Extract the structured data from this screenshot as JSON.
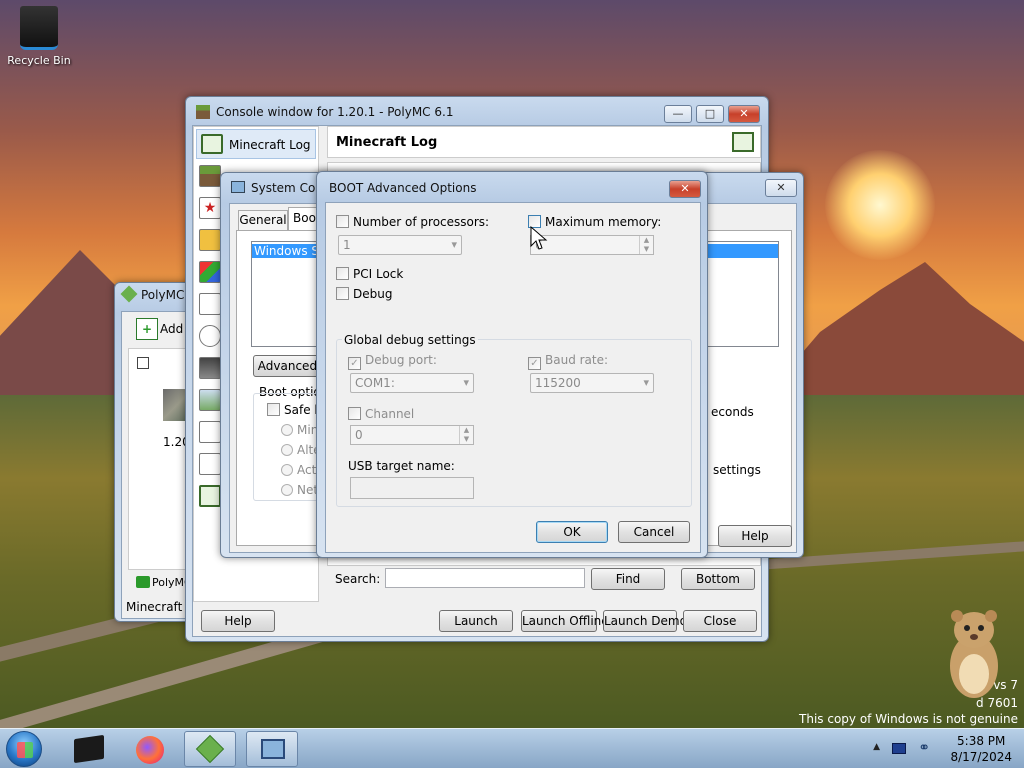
{
  "desktop": {
    "recycle_bin_label": "Recycle Bin",
    "watermark": {
      "line1": "vs 7",
      "line2": "d 7601",
      "line3": "This copy of Windows is not genuine"
    }
  },
  "polymc_main": {
    "title": "PolyMC",
    "add_label": "Add",
    "instance_version": "1.20",
    "status_tab": "PolyMC",
    "footer": "Minecraft 1"
  },
  "console_window": {
    "title": "Console window for 1.20.1 - PolyMC 6.1",
    "sidebar_selected": "Minecraft Log",
    "page_title": "Minecraft Log",
    "search_label": "Search:",
    "find_button": "Find",
    "bottom_button": "Bottom",
    "help_button": "Help",
    "launch_button": "Launch",
    "launch_offline_button": "Launch Offline",
    "launch_demo_button": "Launch Demo",
    "close_button": "Close"
  },
  "system_config": {
    "title": "System Conf",
    "tabs": [
      "General",
      "Boot"
    ],
    "os_entry": "Windows Shir",
    "advanced_button": "Advanced o",
    "boot_options_label": "Boot options",
    "safe_boot_label": "Safe bo",
    "radio_options": [
      "Minin",
      "Alter",
      "Activ",
      "Netw"
    ],
    "seconds_label": "econds",
    "settings_label": "settings",
    "help_button": "Help"
  },
  "boot_advanced": {
    "title": "BOOT Advanced Options",
    "num_processors_label": "Number of processors:",
    "num_processors_value": "1",
    "max_memory_label": "Maximum memory:",
    "max_memory_value": "6",
    "pci_lock_label": "PCI Lock",
    "debug_label": "Debug",
    "global_debug_label": "Global debug settings",
    "debug_port_label": "Debug port:",
    "debug_port_value": "COM1:",
    "baud_rate_label": "Baud rate:",
    "baud_rate_value": "115200",
    "channel_label": "Channel",
    "channel_value": "0",
    "usb_target_label": "USB target name:",
    "ok_button": "OK",
    "cancel_button": "Cancel"
  },
  "taskbar": {
    "time": "5:38 PM",
    "date": "8/17/2024"
  }
}
